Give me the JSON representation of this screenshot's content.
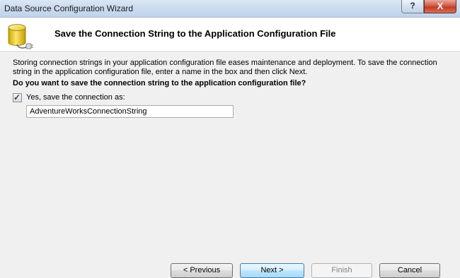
{
  "window": {
    "title": "Data Source Configuration Wizard",
    "help_glyph": "?",
    "close_glyph": "X"
  },
  "header": {
    "heading": "Save the Connection String to the Application Configuration File",
    "icon": "database-connection-icon"
  },
  "content": {
    "description": "Storing connection strings in your application configuration file eases maintenance and deployment. To save the connection string in the application configuration file, enter a name in the box and then click Next.",
    "question": "Do you want to save the connection string to the application configuration file?",
    "save_checkbox": {
      "label": "Yes, save the connection as:",
      "checked": true,
      "check_glyph": "✓"
    },
    "connection_name_value": "AdventureWorksConnectionString"
  },
  "buttons": {
    "previous": "< Previous",
    "next": "Next >",
    "finish": "Finish",
    "cancel": "Cancel"
  },
  "colors": {
    "content_background": "#f0f0f0",
    "close_button": "#c13a24",
    "next_button_border": "#3c7fb1",
    "disabled_text": "#838383"
  }
}
